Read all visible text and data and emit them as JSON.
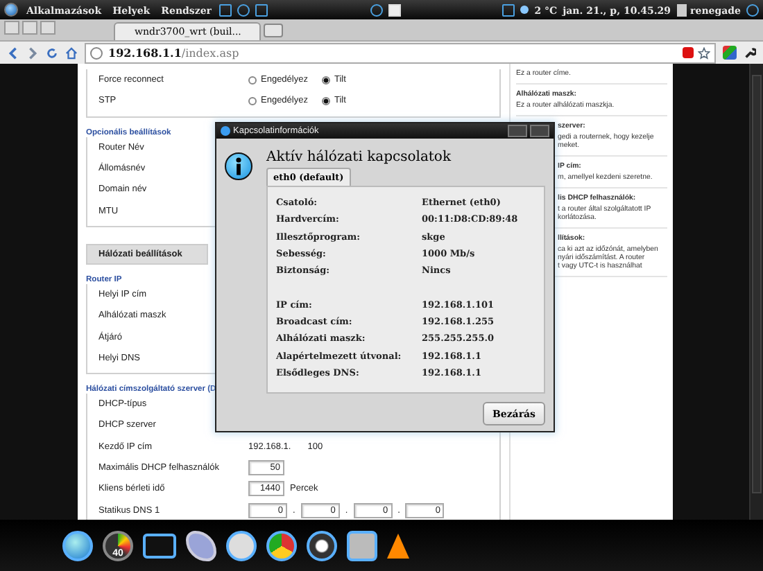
{
  "top_panel": {
    "menus": [
      "Alkalmazások",
      "Helyek",
      "Rendszer"
    ],
    "temperature": "2 °C",
    "clock": "jan. 21., p, 10.45.29",
    "user": "renegade"
  },
  "browser": {
    "tab_title": "wndr3700_wrt (buil...",
    "url_host": "192.168.1.1",
    "url_path": "/index.asp"
  },
  "form": [
    {
      "kind": "group",
      "rows": [
        {
          "label": "Force reconnect",
          "kind": "radio",
          "options": [
            {
              "label": "Engedélyez",
              "selected": false
            },
            {
              "label": "Tilt",
              "selected": true
            }
          ]
        },
        {
          "label": "STP",
          "kind": "radio",
          "options": [
            {
              "label": "Engedélyez",
              "selected": false
            },
            {
              "label": "Tilt",
              "selected": true
            }
          ]
        }
      ]
    },
    {
      "kind": "subhead",
      "title": "Opcionális beállítások",
      "rows": [
        {
          "label": "Router Név",
          "kind": "plain"
        },
        {
          "label": "Állomásnév",
          "kind": "plain"
        },
        {
          "label": "Domain név",
          "kind": "plain"
        },
        {
          "label": "MTU",
          "kind": "plain"
        }
      ]
    },
    {
      "kind": "bar",
      "title": "Hálózati beállítások"
    },
    {
      "kind": "subhead",
      "title": "Router IP",
      "rows": [
        {
          "label": "Helyi IP cím",
          "kind": "plain"
        },
        {
          "label": "Alhálózati maszk",
          "kind": "plain"
        },
        {
          "label": "Átjáró",
          "kind": "plain"
        },
        {
          "label": "Helyi DNS",
          "kind": "plain"
        }
      ]
    },
    {
      "kind": "subhead",
      "title": "Hálózati címszolgáltató szerver (D",
      "rows": [
        {
          "label": "DHCP-típus",
          "kind": "plain"
        },
        {
          "label": "DHCP szerver",
          "kind": "plain"
        },
        {
          "label": "Kezdő IP cím",
          "kind": "prefixed",
          "prefix": "192.168.1.",
          "value": "100"
        },
        {
          "label": "Maximális DHCP felhasználók",
          "kind": "input",
          "value": "50"
        },
        {
          "label": "Kliens bérleti idő",
          "kind": "input",
          "value": "1440",
          "unit": "Percek"
        },
        {
          "label": "Statikus DNS 1",
          "kind": "ip",
          "values": [
            "0",
            "0",
            "0",
            "0"
          ],
          "separator": "."
        }
      ]
    }
  ],
  "help": [
    {
      "lines": [
        "Ez a router címe."
      ],
      "clipped": false
    },
    {
      "title": "Alhálózati maszk:",
      "lines": [
        "Ez a router alhálózati maszkja."
      ],
      "clipped": false
    },
    {
      "title": "szerver:",
      "lines": [
        "gedi a routernek, hogy kezelje",
        "meket."
      ],
      "clipped": true
    },
    {
      "title": "IP cím:",
      "lines": [
        "m, amellyel kezdeni szeretne."
      ],
      "clipped": true
    },
    {
      "title": "lis DHCP felhasználók:",
      "lines": [
        "t a router által szolgáltatott IP",
        "korlátozása."
      ],
      "clipped": true
    },
    {
      "title": "llítások:",
      "lines": [
        "ca ki azt az időzónát, amelyben",
        "nyári időszámítást. A router",
        "t vagy UTC-t is használhat"
      ],
      "clipped": true
    }
  ],
  "dialog": {
    "title": "Kapcsolatinformációk",
    "heading": "Aktív hálózati kapcsolatok",
    "tabs": [
      {
        "label": "eth0 (default)",
        "selected": true
      }
    ],
    "groups": [
      [
        {
          "label": "Csatoló:",
          "value": "Ethernet (eth0)"
        },
        {
          "label": "Hardvercím:",
          "value": "00:11:D8:CD:89:48"
        },
        {
          "label": "Illesztőprogram:",
          "value": "skge"
        },
        {
          "label": "Sebesség:",
          "value": "1000 Mb/s"
        },
        {
          "label": "Biztonság:",
          "value": "Nincs"
        }
      ],
      [
        {
          "label": "IP cím:",
          "value": "192.168.1.101"
        },
        {
          "label": "Broadcast cím:",
          "value": "192.168.1.255"
        },
        {
          "label": "Alhálózati maszk:",
          "value": "255.255.255.0"
        },
        {
          "label": "Alapértelmezett útvonal:",
          "value": "192.168.1.1"
        },
        {
          "label": "Elsődleges DNS:",
          "value": "192.168.1.1"
        }
      ]
    ],
    "button": "Bezárás"
  },
  "dock": {
    "gauge_value": "40"
  }
}
